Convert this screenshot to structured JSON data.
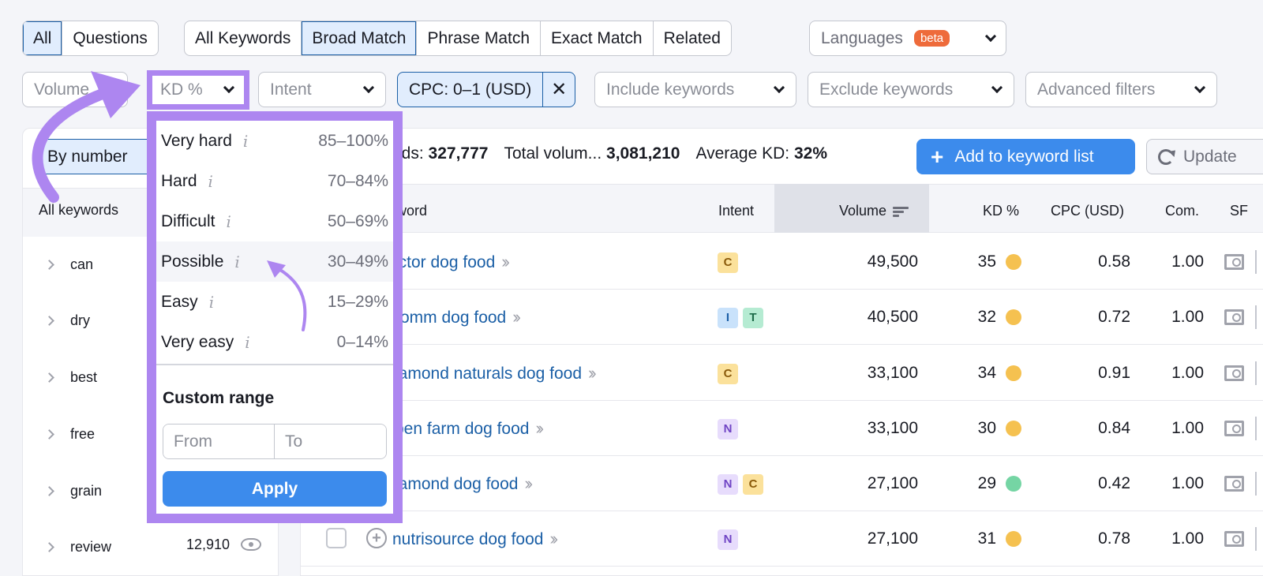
{
  "top_tabs_group1": [
    {
      "label": "All",
      "active": true
    },
    {
      "label": "Questions",
      "active": false
    }
  ],
  "top_tabs_group2": [
    {
      "label": "All Keywords",
      "active": false
    },
    {
      "label": "Broad Match",
      "active": true
    },
    {
      "label": "Phrase Match",
      "active": false
    },
    {
      "label": "Exact Match",
      "active": false
    },
    {
      "label": "Related",
      "active": false
    }
  ],
  "languages": {
    "label": "Languages",
    "badge": "beta"
  },
  "filters": {
    "volume": "Volume",
    "kd": "KD %",
    "intent": "Intent",
    "cpc": "CPC: 0–1 (USD)",
    "cpc_clear": "✕",
    "include": "Include keywords",
    "exclude": "Exclude keywords",
    "advanced": "Advanced filters"
  },
  "left_panel": {
    "toggle": "By number",
    "header": "All keywords",
    "groups": [
      {
        "label": "can"
      },
      {
        "label": "dry"
      },
      {
        "label": "best"
      },
      {
        "label": "free"
      },
      {
        "label": "grain"
      },
      {
        "label": "review",
        "count": "12,910"
      }
    ]
  },
  "summary": {
    "keywords_label": "ords:",
    "keywords_value": "327,777",
    "volume_label": "Total volum...",
    "volume_value": "3,081,210",
    "avg_kd_label": "Average KD:",
    "avg_kd_value": "32%"
  },
  "actions": {
    "add_plus": "+",
    "add_label": "Add to keyword list",
    "update_label": "Update"
  },
  "table": {
    "headers": {
      "keyword": "word",
      "intent": "Intent",
      "volume": "Volume",
      "kd": "KD %",
      "cpc": "CPC (USD)",
      "com": "Com.",
      "sf": "SF"
    },
    "rows": [
      {
        "keyword": "ictor dog food",
        "intents": [
          "C"
        ],
        "volume": "49,500",
        "kd": "35",
        "kd_color": "#f5c150",
        "cpc": "0.58",
        "com": "1.00"
      },
      {
        "keyword": "romm dog food",
        "intents": [
          "I",
          "T"
        ],
        "volume": "40,500",
        "kd": "32",
        "kd_color": "#f5c150",
        "cpc": "0.72",
        "com": "1.00"
      },
      {
        "keyword": "iamond naturals dog food",
        "intents": [
          "C"
        ],
        "volume": "33,100",
        "kd": "34",
        "kd_color": "#f5c150",
        "cpc": "0.91",
        "com": "1.00"
      },
      {
        "keyword": "pen farm dog food",
        "intents": [
          "N"
        ],
        "volume": "33,100",
        "kd": "30",
        "kd_color": "#f5c150",
        "cpc": "0.84",
        "com": "1.00"
      },
      {
        "keyword": "iamond dog food",
        "intents": [
          "N",
          "C"
        ],
        "volume": "27,100",
        "kd": "29",
        "kd_color": "#75d5a4",
        "cpc": "0.42",
        "com": "1.00"
      },
      {
        "keyword": "nutrisource dog food",
        "intents": [
          "N"
        ],
        "volume": "27,100",
        "kd": "31",
        "kd_color": "#f5c150",
        "cpc": "0.78",
        "com": "1.00"
      }
    ]
  },
  "intent_colors": {
    "C": {
      "bg": "#fbe19b",
      "fg": "#8a5a0b"
    },
    "I": {
      "bg": "#c9e2fb",
      "fg": "#1b5fa6"
    },
    "T": {
      "bg": "#b5ebd2",
      "fg": "#1d6b49"
    },
    "N": {
      "bg": "#e7dcfc",
      "fg": "#6f44c4"
    }
  },
  "kd_dropdown": {
    "options": [
      {
        "label": "Very hard",
        "range": "85–100%"
      },
      {
        "label": "Hard",
        "range": "70–84%"
      },
      {
        "label": "Difficult",
        "range": "50–69%"
      },
      {
        "label": "Possible",
        "range": "30–49%"
      },
      {
        "label": "Easy",
        "range": "15–29%"
      },
      {
        "label": "Very easy",
        "range": "0–14%"
      }
    ],
    "info_glyph": "i",
    "custom_range_label": "Custom range",
    "from_placeholder": "From",
    "to_placeholder": "To",
    "apply_label": "Apply"
  },
  "colors": {
    "accent": "#3c8bec",
    "active_tab_bg": "#e1edfd",
    "annotation": "#ad86f0",
    "beta": "#ee6b3b",
    "link": "#1b5fa6"
  }
}
